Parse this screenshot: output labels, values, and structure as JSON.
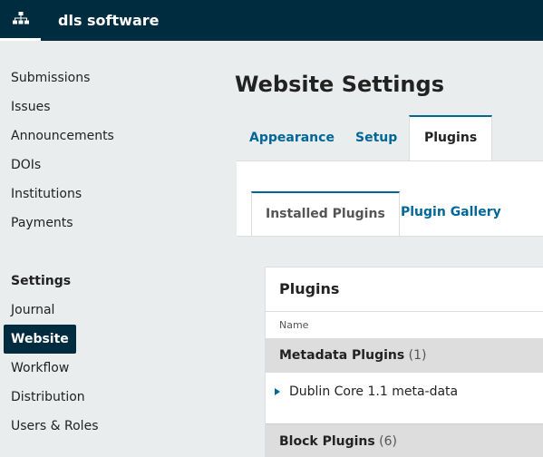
{
  "app": {
    "title": "dls software",
    "home_icon": "sitemap-icon"
  },
  "sidebar": {
    "items": [
      {
        "label": "Submissions"
      },
      {
        "label": "Issues"
      },
      {
        "label": "Announcements"
      },
      {
        "label": "DOIs"
      },
      {
        "label": "Institutions"
      },
      {
        "label": "Payments"
      }
    ],
    "settings_heading": "Settings",
    "settings_items": [
      {
        "label": "Journal"
      },
      {
        "label": "Website",
        "active": true
      },
      {
        "label": "Workflow"
      },
      {
        "label": "Distribution"
      },
      {
        "label": "Users & Roles"
      }
    ]
  },
  "main": {
    "title": "Website Settings",
    "tabs": [
      {
        "label": "Appearance"
      },
      {
        "label": "Setup"
      },
      {
        "label": "Plugins",
        "active": true
      }
    ],
    "subtabs": [
      {
        "label": "Installed Plugins",
        "active": true
      },
      {
        "label": "Plugin Gallery"
      }
    ],
    "grid": {
      "title": "Plugins",
      "column_name": "Name",
      "categories": [
        {
          "name": "Metadata Plugins",
          "count": "(1)",
          "rows": [
            "Dublin Core 1.1 meta-data"
          ]
        },
        {
          "name": "Block Plugins",
          "count": "(6)",
          "rows": []
        }
      ]
    }
  }
}
